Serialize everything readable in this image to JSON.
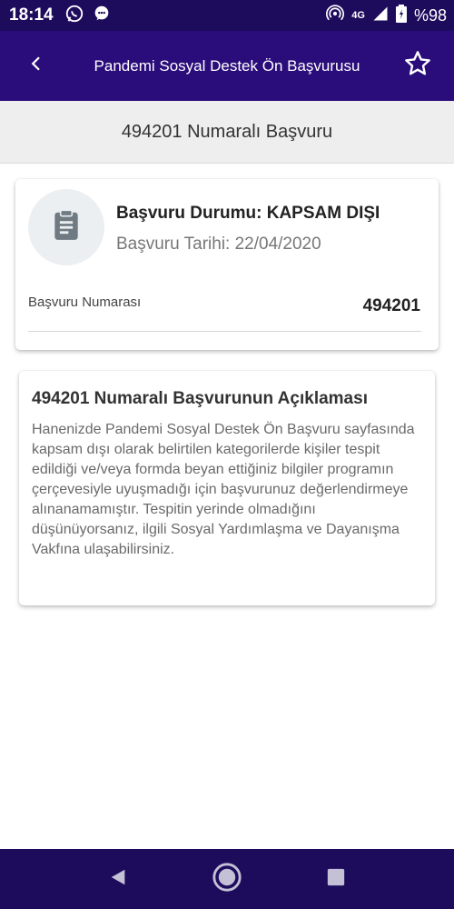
{
  "status_bar": {
    "time": "18:14",
    "network": "4G",
    "battery": "%98"
  },
  "app_bar": {
    "title": "Pandemi Sosyal Destek Ön Başvurusu"
  },
  "subheader": {
    "title": "494201 Numaralı Başvuru"
  },
  "summary_card": {
    "status": "Başvuru Durumu: KAPSAM DIŞI",
    "date": "Başvuru Tarihi: 22/04/2020",
    "number_label": "Başvuru Numarası",
    "number_value": "494201"
  },
  "description_card": {
    "title": "494201 Numaralı Başvurunun Açıklaması",
    "text": "Hanenizde Pandemi Sosyal Destek Ön Başvuru sayfasında kapsam dışı olarak belirtilen kategorilerde kişiler tespit edildiği ve/veya formda beyan ettiğiniz bilgiler programın çerçevesiyle uyuşmadığı için başvurunuz değerlendirmeye alınanamamıştır. Tespitin yerinde olmadığını düşünüyorsanız, ilgili Sosyal Yardımlaşma ve Dayanışma Vakfına ulaşabilirsiniz."
  },
  "colors": {
    "status_bar": "#1d0c5c",
    "app_bar": "#2a0d7a",
    "subheader": "#eeeeee"
  }
}
